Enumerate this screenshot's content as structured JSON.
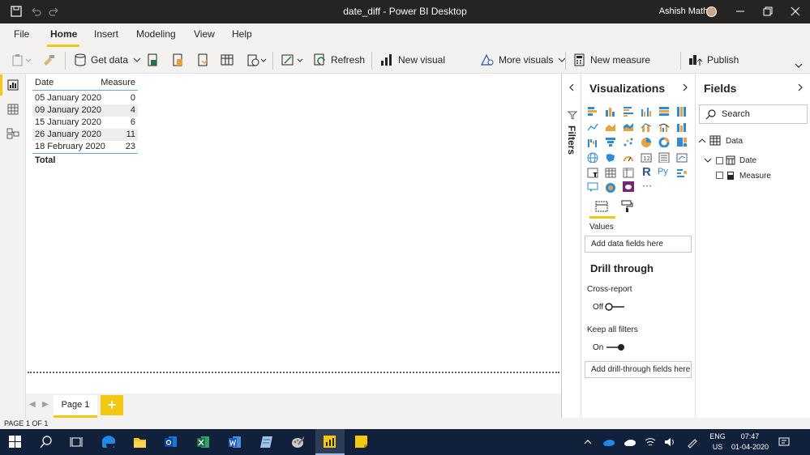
{
  "window": {
    "title": "date_diff - Power BI Desktop",
    "user": "Ashish Mathur"
  },
  "menu": {
    "items": [
      "File",
      "Home",
      "Insert",
      "Modeling",
      "View",
      "Help"
    ],
    "active": "Home"
  },
  "ribbon": {
    "get_data": "Get data",
    "refresh": "Refresh",
    "new_visual": "New visual",
    "more_visuals": "More visuals",
    "new_measure": "New measure",
    "publish": "Publish"
  },
  "table_visual": {
    "columns": [
      "Date",
      "Measure"
    ],
    "rows": [
      {
        "date": "05 January 2020",
        "measure": "0"
      },
      {
        "date": "09 January 2020",
        "measure": "4"
      },
      {
        "date": "15 January 2020",
        "measure": "6"
      },
      {
        "date": "26 January 2020",
        "measure": "11"
      },
      {
        "date": "18 February 2020",
        "measure": "23"
      }
    ],
    "total_label": "Total"
  },
  "pages": {
    "tab": "Page 1",
    "add": "+",
    "status": "PAGE 1 OF 1"
  },
  "filters": {
    "label": "Filters"
  },
  "visualizations": {
    "title": "Visualizations",
    "values_label": "Values",
    "values_drop": "Add data fields here",
    "drill_title": "Drill through",
    "cross_report": "Cross-report",
    "cross_report_state": "Off",
    "keep_filters": "Keep all filters",
    "keep_filters_state": "On",
    "drill_drop": "Add drill-through fields here"
  },
  "fields": {
    "title": "Fields",
    "search_placeholder": "Search",
    "table_name": "Data",
    "items": [
      "Date",
      "Measure"
    ]
  },
  "taskbar": {
    "lang1": "ENG",
    "lang2": "US",
    "time": "07:47",
    "date": "01-04-2020"
  },
  "colors": {
    "accent": "#f2c811",
    "chrome": "#252423",
    "taskbar": "#12213b"
  }
}
